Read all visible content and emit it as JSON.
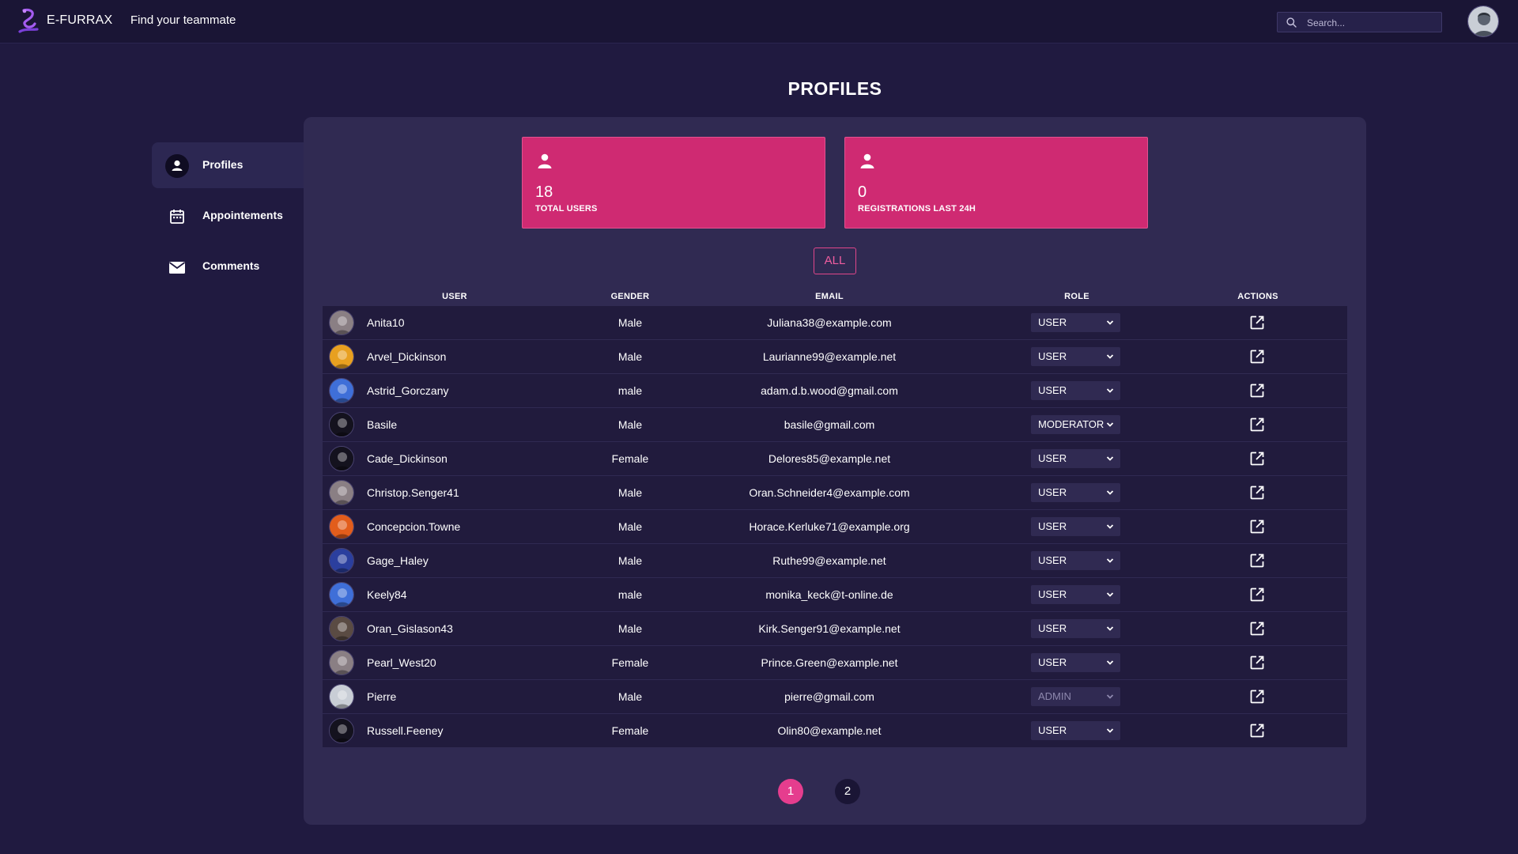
{
  "header": {
    "brand": "E-FURRAX",
    "tagline": "Find your teammate",
    "search_placeholder": "Search..."
  },
  "page_title": "PROFILES",
  "sidebar": {
    "items": [
      {
        "label": "Profiles",
        "icon": "person-icon",
        "active": true
      },
      {
        "label": "Appointements",
        "icon": "calendar-icon",
        "active": false
      },
      {
        "label": "Comments",
        "icon": "mail-icon",
        "active": false
      }
    ]
  },
  "stats": [
    {
      "value": "18",
      "label": "TOTAL USERS"
    },
    {
      "value": "0",
      "label": "REGISTRATIONS LAST 24H"
    }
  ],
  "filter_label": "ALL",
  "table": {
    "headers": {
      "user": "USER",
      "gender": "GENDER",
      "email": "EMAIL",
      "role": "ROLE",
      "actions": "ACTIONS"
    },
    "rows": [
      {
        "username": "Anita10",
        "gender": "Male",
        "email": "Juliana38@example.com",
        "role": "USER",
        "avatar": "#8a7f84"
      },
      {
        "username": "Arvel_Dickinson",
        "gender": "Male",
        "email": "Laurianne99@example.net",
        "role": "USER",
        "avatar": "#e8a020"
      },
      {
        "username": "Astrid_Gorczany",
        "gender": "male",
        "email": "adam.d.b.wood@gmail.com",
        "role": "USER",
        "avatar": "#3f6fd8"
      },
      {
        "username": "Basile",
        "gender": "Male",
        "email": "basile@gmail.com",
        "role": "MODERATOR",
        "avatar": "#14121e"
      },
      {
        "username": "Cade_Dickinson",
        "gender": "Female",
        "email": "Delores85@example.net",
        "role": "USER",
        "avatar": "#14121e"
      },
      {
        "username": "Christop.Senger41",
        "gender": "Male",
        "email": "Oran.Schneider4@example.com",
        "role": "USER",
        "avatar": "#8a7f84"
      },
      {
        "username": "Concepcion.Towne",
        "gender": "Male",
        "email": "Horace.Kerluke71@example.org",
        "role": "USER",
        "avatar": "#e25d1c"
      },
      {
        "username": "Gage_Haley",
        "gender": "Male",
        "email": "Ruthe99@example.net",
        "role": "USER",
        "avatar": "#2b3f9e"
      },
      {
        "username": "Keely84",
        "gender": "male",
        "email": "monika_keck@t-online.de",
        "role": "USER",
        "avatar": "#3f6fd8"
      },
      {
        "username": "Oran_Gislason43",
        "gender": "Male",
        "email": "Kirk.Senger91@example.net",
        "role": "USER",
        "avatar": "#5a4b43"
      },
      {
        "username": "Pearl_West20",
        "gender": "Female",
        "email": "Prince.Green@example.net",
        "role": "USER",
        "avatar": "#8a7f84"
      },
      {
        "username": "Pierre",
        "gender": "Male",
        "email": "pierre@gmail.com",
        "role": "ADMIN",
        "role_disabled": true,
        "avatar": "#c9ced6"
      },
      {
        "username": "Russell.Feeney",
        "gender": "Female",
        "email": "Olin80@example.net",
        "role": "USER",
        "avatar": "#14121e"
      }
    ]
  },
  "pagination": {
    "pages": [
      "1",
      "2"
    ],
    "current": "1"
  },
  "colors": {
    "background": "#201a40",
    "topbar": "#1a1535",
    "panel": "#302a52",
    "row": "#211b3d",
    "accent": "#cf2a72",
    "accent_light": "#e53d8e"
  }
}
